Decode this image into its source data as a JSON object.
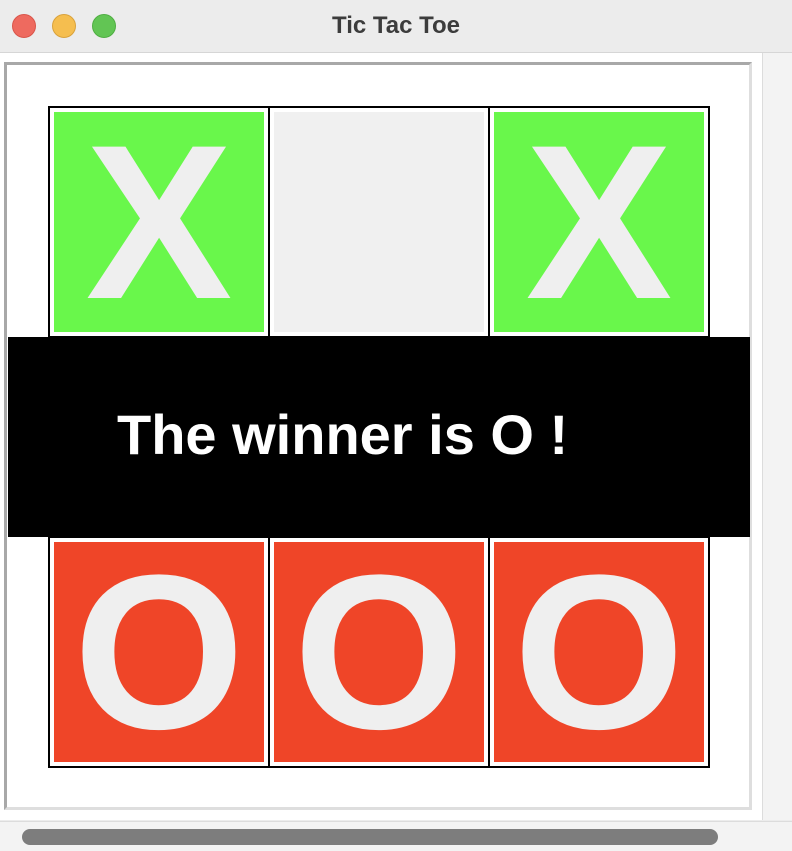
{
  "window": {
    "title": "Tic Tac Toe"
  },
  "colors": {
    "x_cell": "#69f74b",
    "o_cell": "#ef4528",
    "empty_cell": "#f0f0f0",
    "mark": "#efefef"
  },
  "board": {
    "cells": [
      {
        "mark": "X",
        "state": "x"
      },
      {
        "mark": "",
        "state": "empty"
      },
      {
        "mark": "X",
        "state": "x"
      },
      {
        "mark": "",
        "state": "hidden"
      },
      {
        "mark": "",
        "state": "x"
      },
      {
        "mark": "",
        "state": "hidden"
      },
      {
        "mark": "O",
        "state": "o"
      },
      {
        "mark": "O",
        "state": "o"
      },
      {
        "mark": "O",
        "state": "o"
      }
    ]
  },
  "banner": {
    "text": "The winner is O !"
  }
}
